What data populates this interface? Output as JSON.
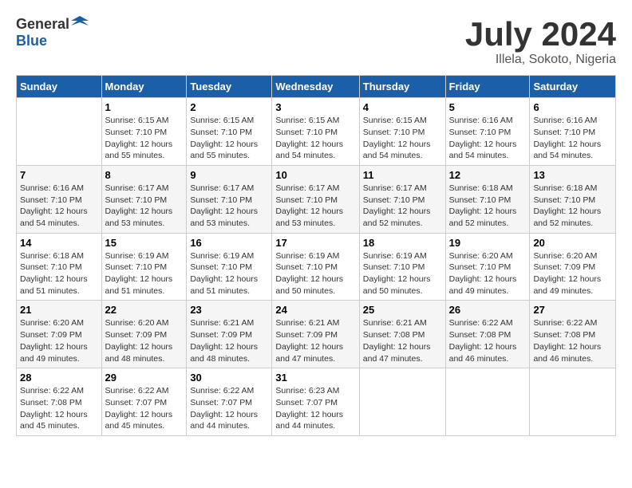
{
  "header": {
    "logo_general": "General",
    "logo_blue": "Blue",
    "title": "July 2024",
    "location": "Illela, Sokoto, Nigeria"
  },
  "days_of_week": [
    "Sunday",
    "Monday",
    "Tuesday",
    "Wednesday",
    "Thursday",
    "Friday",
    "Saturday"
  ],
  "weeks": [
    [
      {
        "day": "",
        "info": ""
      },
      {
        "day": "1",
        "info": "Sunrise: 6:15 AM\nSunset: 7:10 PM\nDaylight: 12 hours\nand 55 minutes."
      },
      {
        "day": "2",
        "info": "Sunrise: 6:15 AM\nSunset: 7:10 PM\nDaylight: 12 hours\nand 55 minutes."
      },
      {
        "day": "3",
        "info": "Sunrise: 6:15 AM\nSunset: 7:10 PM\nDaylight: 12 hours\nand 54 minutes."
      },
      {
        "day": "4",
        "info": "Sunrise: 6:15 AM\nSunset: 7:10 PM\nDaylight: 12 hours\nand 54 minutes."
      },
      {
        "day": "5",
        "info": "Sunrise: 6:16 AM\nSunset: 7:10 PM\nDaylight: 12 hours\nand 54 minutes."
      },
      {
        "day": "6",
        "info": "Sunrise: 6:16 AM\nSunset: 7:10 PM\nDaylight: 12 hours\nand 54 minutes."
      }
    ],
    [
      {
        "day": "7",
        "info": ""
      },
      {
        "day": "8",
        "info": "Sunrise: 6:17 AM\nSunset: 7:10 PM\nDaylight: 12 hours\nand 53 minutes."
      },
      {
        "day": "9",
        "info": "Sunrise: 6:17 AM\nSunset: 7:10 PM\nDaylight: 12 hours\nand 53 minutes."
      },
      {
        "day": "10",
        "info": "Sunrise: 6:17 AM\nSunset: 7:10 PM\nDaylight: 12 hours\nand 53 minutes."
      },
      {
        "day": "11",
        "info": "Sunrise: 6:17 AM\nSunset: 7:10 PM\nDaylight: 12 hours\nand 52 minutes."
      },
      {
        "day": "12",
        "info": "Sunrise: 6:18 AM\nSunset: 7:10 PM\nDaylight: 12 hours\nand 52 minutes."
      },
      {
        "day": "13",
        "info": "Sunrise: 6:18 AM\nSunset: 7:10 PM\nDaylight: 12 hours\nand 52 minutes."
      }
    ],
    [
      {
        "day": "14",
        "info": ""
      },
      {
        "day": "15",
        "info": "Sunrise: 6:19 AM\nSunset: 7:10 PM\nDaylight: 12 hours\nand 51 minutes."
      },
      {
        "day": "16",
        "info": "Sunrise: 6:19 AM\nSunset: 7:10 PM\nDaylight: 12 hours\nand 51 minutes."
      },
      {
        "day": "17",
        "info": "Sunrise: 6:19 AM\nSunset: 7:10 PM\nDaylight: 12 hours\nand 50 minutes."
      },
      {
        "day": "18",
        "info": "Sunrise: 6:19 AM\nSunset: 7:10 PM\nDaylight: 12 hours\nand 50 minutes."
      },
      {
        "day": "19",
        "info": "Sunrise: 6:20 AM\nSunset: 7:10 PM\nDaylight: 12 hours\nand 49 minutes."
      },
      {
        "day": "20",
        "info": "Sunrise: 6:20 AM\nSunset: 7:09 PM\nDaylight: 12 hours\nand 49 minutes."
      }
    ],
    [
      {
        "day": "21",
        "info": ""
      },
      {
        "day": "22",
        "info": "Sunrise: 6:20 AM\nSunset: 7:09 PM\nDaylight: 12 hours\nand 48 minutes."
      },
      {
        "day": "23",
        "info": "Sunrise: 6:21 AM\nSunset: 7:09 PM\nDaylight: 12 hours\nand 48 minutes."
      },
      {
        "day": "24",
        "info": "Sunrise: 6:21 AM\nSunset: 7:09 PM\nDaylight: 12 hours\nand 47 minutes."
      },
      {
        "day": "25",
        "info": "Sunrise: 6:21 AM\nSunset: 7:08 PM\nDaylight: 12 hours\nand 47 minutes."
      },
      {
        "day": "26",
        "info": "Sunrise: 6:22 AM\nSunset: 7:08 PM\nDaylight: 12 hours\nand 46 minutes."
      },
      {
        "day": "27",
        "info": "Sunrise: 6:22 AM\nSunset: 7:08 PM\nDaylight: 12 hours\nand 46 minutes."
      }
    ],
    [
      {
        "day": "28",
        "info": "Sunrise: 6:22 AM\nSunset: 7:08 PM\nDaylight: 12 hours\nand 45 minutes."
      },
      {
        "day": "29",
        "info": "Sunrise: 6:22 AM\nSunset: 7:07 PM\nDaylight: 12 hours\nand 45 minutes."
      },
      {
        "day": "30",
        "info": "Sunrise: 6:22 AM\nSunset: 7:07 PM\nDaylight: 12 hours\nand 44 minutes."
      },
      {
        "day": "31",
        "info": "Sunrise: 6:23 AM\nSunset: 7:07 PM\nDaylight: 12 hours\nand 44 minutes."
      },
      {
        "day": "",
        "info": ""
      },
      {
        "day": "",
        "info": ""
      },
      {
        "day": "",
        "info": ""
      }
    ]
  ],
  "week1_sunday_info": "Sunrise: 6:16 AM\nSunset: 7:10 PM\nDaylight: 12 hours\nand 54 minutes.",
  "week2_sunday_info": "Sunrise: 6:16 AM\nSunset: 7:10 PM\nDaylight: 12 hours\nand 54 minutes.",
  "week3_sunday_info": "Sunrise: 6:18 AM\nSunset: 7:10 PM\nDaylight: 12 hours\nand 51 minutes.",
  "week4_sunday_info": "Sunrise: 6:20 AM\nSunset: 7:09 PM\nDaylight: 12 hours\nand 49 minutes."
}
